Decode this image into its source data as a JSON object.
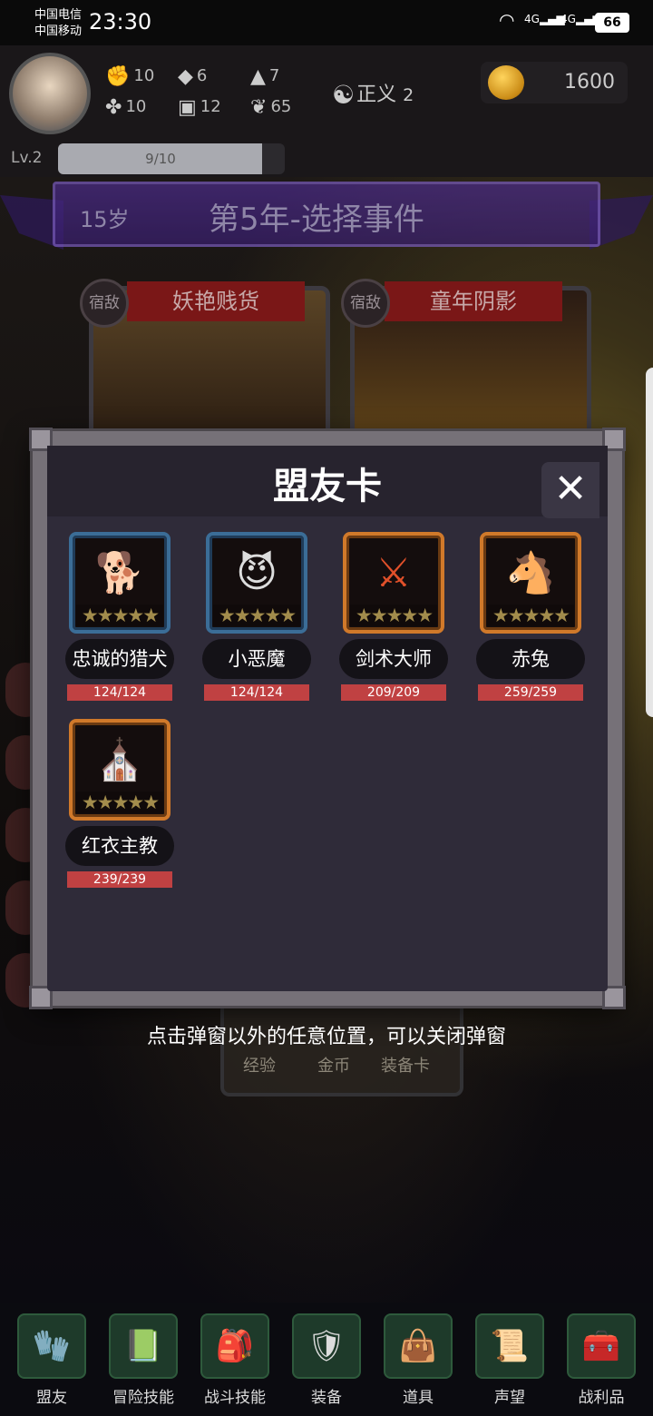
{
  "status_bar": {
    "carrier1": "中国电信",
    "carrier2": "中国移动",
    "time": "23:30",
    "net1": "4G",
    "net2": "4G",
    "battery": "66"
  },
  "hud": {
    "stats": [
      {
        "icon": "fist-icon",
        "value": "10"
      },
      {
        "icon": "boot-icon",
        "value": "6"
      },
      {
        "icon": "wizard-hat-icon",
        "value": "7"
      },
      {
        "icon": "clover-icon",
        "value": "10"
      },
      {
        "icon": "book-icon",
        "value": "12"
      },
      {
        "icon": "lotus-icon",
        "value": "65"
      }
    ],
    "alignment": "正义",
    "alignment_value": "2",
    "gold": "1600",
    "level": "Lv.2",
    "xp": "9/10",
    "xp_progress": 0.9
  },
  "banner": {
    "age": "15岁",
    "title": "第5年-选择事件"
  },
  "events": [
    {
      "tag": "宿敌",
      "title": "妖艳贱货"
    },
    {
      "tag": "宿敌",
      "title": "童年阴影"
    }
  ],
  "popup": {
    "title": "盟友卡",
    "allies": [
      {
        "name": "忠诚的猎犬",
        "hp": "124/124",
        "frame": "blue",
        "art": "🐕"
      },
      {
        "name": "小恶魔",
        "hp": "124/124",
        "frame": "blue",
        "art": "😈"
      },
      {
        "name": "剑术大师",
        "hp": "209/209",
        "frame": "orange",
        "art": "⚔"
      },
      {
        "name": "赤兔",
        "hp": "259/259",
        "frame": "orange",
        "art": "🐴"
      },
      {
        "name": "红衣主教",
        "hp": "239/239",
        "frame": "orange",
        "art": "⛪"
      }
    ],
    "stars": "★★★★★"
  },
  "hint": "点击弹窗以外的任意位置，可以关闭弹窗",
  "rewards": [
    "经验",
    "金币",
    "装备卡"
  ],
  "nav": [
    {
      "label": "盟友",
      "icon": "glove-icon"
    },
    {
      "label": "冒险技能",
      "icon": "tome-icon"
    },
    {
      "label": "战斗技能",
      "icon": "backpack-icon"
    },
    {
      "label": "装备",
      "icon": "shield-swords-icon"
    },
    {
      "label": "道具",
      "icon": "satchel-icon"
    },
    {
      "label": "声望",
      "icon": "scroll-icon"
    },
    {
      "label": "战利品",
      "icon": "chest-icon"
    }
  ]
}
